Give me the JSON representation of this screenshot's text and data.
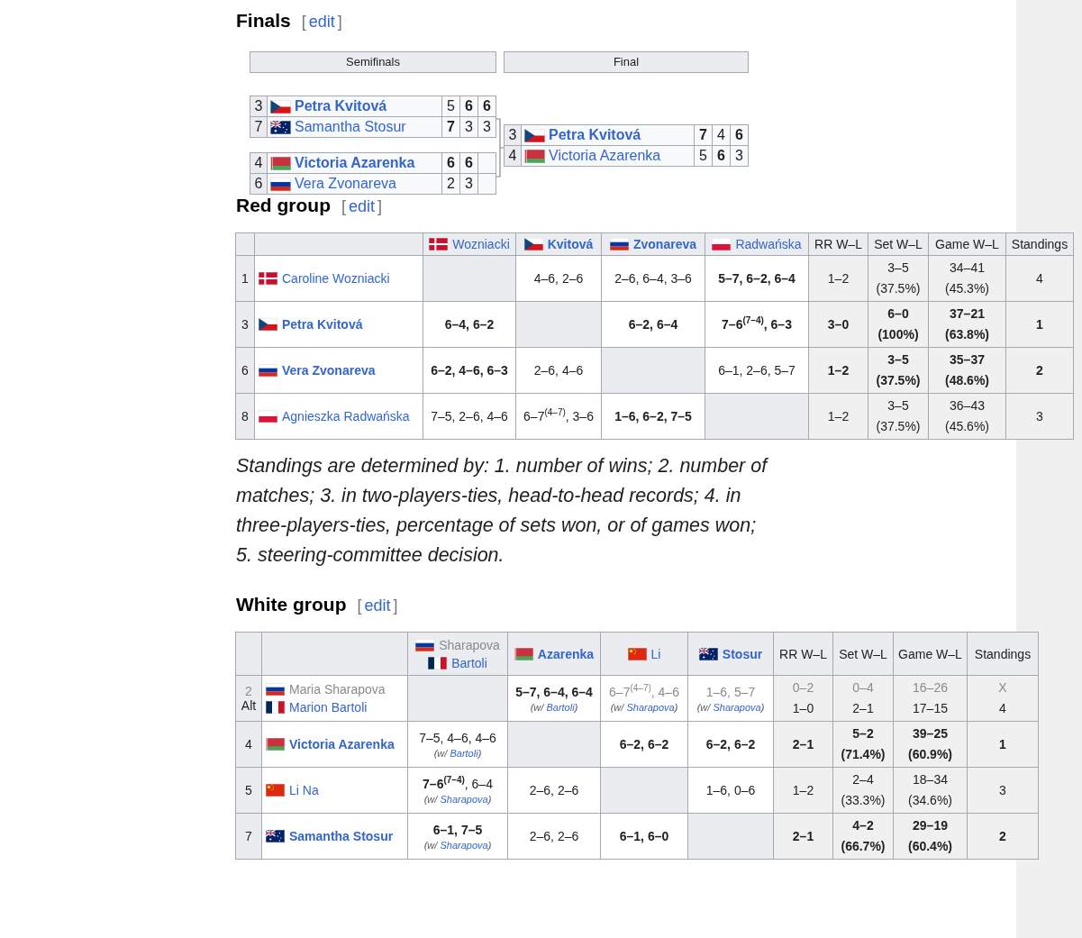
{
  "finals": {
    "heading": "Finals",
    "edit": {
      "open": "[",
      "label": "edit",
      "close": "]"
    },
    "rounds": [
      {
        "title": "Semifinals",
        "matches": [
          [
            {
              "seed": "3",
              "kind": "cze",
              "name": "Petra Kvitová",
              "bold": true,
              "scores": [
                {
                  "text": "5",
                  "bold": false
                },
                {
                  "text": "6",
                  "bold": true
                },
                {
                  "text": "6",
                  "bold": true
                }
              ]
            },
            {
              "seed": "7",
              "kind": "aus",
              "name": "Samantha Stosur",
              "bold": false,
              "scores": [
                {
                  "text": "7",
                  "bold": true
                },
                {
                  "text": "3",
                  "bold": false
                },
                {
                  "text": "3",
                  "bold": false
                }
              ]
            }
          ],
          [
            {
              "seed": "4",
              "kind": "blr",
              "name": "Victoria Azarenka",
              "bold": true,
              "scores": [
                {
                  "text": "6",
                  "bold": true
                },
                {
                  "text": "6",
                  "bold": true
                }
              ]
            },
            {
              "seed": "6",
              "kind": "rus",
              "name": "Vera Zvonareva",
              "bold": false,
              "scores": [
                {
                  "text": "2",
                  "bold": false
                },
                {
                  "text": "3",
                  "bold": false
                }
              ]
            }
          ]
        ]
      },
      {
        "title": "Final",
        "matches": [
          [
            {
              "seed": "3",
              "kind": "cze",
              "name": "Petra Kvitová",
              "bold": true,
              "scores": [
                {
                  "text": "7",
                  "bold": true
                },
                {
                  "text": "4",
                  "bold": false
                },
                {
                  "text": "6",
                  "bold": true
                }
              ]
            },
            {
              "seed": "4",
              "kind": "blr",
              "name": "Victoria Azarenka",
              "bold": false,
              "scores": [
                {
                  "text": "5",
                  "bold": false
                },
                {
                  "text": "6",
                  "bold": true
                },
                {
                  "text": "3",
                  "bold": false
                }
              ]
            }
          ]
        ]
      }
    ]
  },
  "red_group": {
    "heading": "Red group",
    "edit": {
      "open": "[",
      "label": "edit",
      "close": "]"
    },
    "columns": [
      {
        "players": [
          {
            "kind": "den",
            "name": "Wozniacki",
            "bold": false
          }
        ]
      },
      {
        "players": [
          {
            "kind": "cze",
            "name": "Kvitová",
            "bold": true
          }
        ]
      },
      {
        "players": [
          {
            "kind": "rus",
            "name": "Zvonareva",
            "bold": true
          }
        ]
      },
      {
        "players": [
          {
            "kind": "pol",
            "name": "Radwańska",
            "bold": false
          }
        ]
      }
    ],
    "stat_headers": [
      "RR W–L",
      "Set W–L",
      "Game W–L",
      "Standings"
    ],
    "rows": [
      {
        "seeds": [
          "1"
        ],
        "players": [
          {
            "kind": "den",
            "name": "Caroline Wozniacki",
            "bold": false
          }
        ],
        "bold": false,
        "cells": [
          {
            "kind": "diag"
          },
          {
            "kind": "score",
            "text": "4–6, 2–6",
            "bold": false
          },
          {
            "kind": "score",
            "text": "2–6, 6–4, 3–6",
            "bold": false
          },
          {
            "kind": "score",
            "text": "5–7, 6–2, 6–4",
            "bold": true
          }
        ],
        "stats": [
          {
            "values": [
              "1–2"
            ]
          },
          {
            "values": [
              "3–5",
              "(37.5%)"
            ]
          },
          {
            "values": [
              "34–41",
              "(45.3%)"
            ]
          },
          {
            "values": [
              "4"
            ]
          }
        ]
      },
      {
        "seeds": [
          "3"
        ],
        "players": [
          {
            "kind": "cze",
            "name": "Petra Kvitová",
            "bold": true
          }
        ],
        "bold": true,
        "cells": [
          {
            "kind": "score",
            "text": "6–4, 6–2",
            "bold": true
          },
          {
            "kind": "diag"
          },
          {
            "kind": "score",
            "text": "6–2, 6–4",
            "bold": true
          },
          {
            "kind": "score",
            "text": "7–6$^{(7–4)}$, 6–3",
            "bold": true
          }
        ],
        "stats": [
          {
            "values": [
              "3–0"
            ]
          },
          {
            "values": [
              "6–0",
              "(100%)"
            ]
          },
          {
            "values": [
              "37–21",
              "(63.8%)"
            ]
          },
          {
            "values": [
              "1"
            ]
          }
        ]
      },
      {
        "seeds": [
          "6"
        ],
        "players": [
          {
            "kind": "rus",
            "name": "Vera Zvonareva",
            "bold": true
          }
        ],
        "bold": true,
        "cells": [
          {
            "kind": "score",
            "text": "6–2, 4–6, 6–3",
            "bold": true
          },
          {
            "kind": "score",
            "text": "2–6, 4–6",
            "bold": false
          },
          {
            "kind": "diag"
          },
          {
            "kind": "score",
            "text": "6–1, 2–6, 5–7",
            "bold": false
          }
        ],
        "stats": [
          {
            "values": [
              "1–2"
            ]
          },
          {
            "values": [
              "3–5",
              "(37.5%)"
            ]
          },
          {
            "values": [
              "35–37",
              "(48.6%)"
            ]
          },
          {
            "values": [
              "2"
            ]
          }
        ]
      },
      {
        "seeds": [
          "8"
        ],
        "players": [
          {
            "kind": "pol",
            "name": "Agnieszka Radwańska",
            "bold": false
          }
        ],
        "bold": false,
        "cells": [
          {
            "kind": "score",
            "text": "7–5, 2–6, 4–6",
            "bold": false
          },
          {
            "kind": "score",
            "text": "6–7$^{(4–7)}$, 3–6",
            "bold": false
          },
          {
            "kind": "score",
            "text": "1–6, 6–2, 7–5",
            "bold": true
          },
          {
            "kind": "diag"
          }
        ],
        "stats": [
          {
            "values": [
              "1–2"
            ]
          },
          {
            "values": [
              "3–5",
              "(37.5%)"
            ]
          },
          {
            "values": [
              "36–43",
              "(45.6%)"
            ]
          },
          {
            "values": [
              "3"
            ]
          }
        ]
      }
    ]
  },
  "note": "Standings are determined by: 1. number of wins; 2. number of matches; 3. in two-players-ties, head-to-head records; 4. in three-players-ties, percentage of sets won, or of games won; 5. steering-committee decision.",
  "white_group": {
    "heading": "White group",
    "edit": {
      "open": "[",
      "label": "edit",
      "close": "]"
    },
    "columns": [
      {
        "players": [
          {
            "kind": "rus",
            "name": "Sharapova",
            "bold": false,
            "dim": true
          },
          {
            "kind": "fra",
            "name": "Bartoli",
            "bold": false,
            "dim": false
          }
        ]
      },
      {
        "players": [
          {
            "kind": "blr",
            "name": "Azarenka",
            "bold": true
          }
        ]
      },
      {
        "players": [
          {
            "kind": "chn",
            "name": "Li",
            "bold": false
          }
        ]
      },
      {
        "players": [
          {
            "kind": "aus",
            "name": "Stosur",
            "bold": true
          }
        ]
      }
    ],
    "stat_headers": [
      "RR W–L",
      "Set W–L",
      "Game W–L",
      "Standings"
    ],
    "rows": [
      {
        "seeds": [
          "2",
          "Alt"
        ],
        "players": [
          {
            "kind": "rus",
            "name": "Maria Sharapova",
            "bold": false,
            "dim": true
          },
          {
            "kind": "fra",
            "name": "Marion Bartoli",
            "bold": false,
            "dim": false
          }
        ],
        "bold": false,
        "cells": [
          {
            "kind": "diag"
          },
          {
            "kind": "score",
            "text": "5–7, 6–4, 6–4",
            "bold": true,
            "dim": false,
            "note": {
              "open": "(w/",
              "link": "Bartoli",
              "close": ")"
            }
          },
          {
            "kind": "score",
            "text": "6–7$^{(4–7)}$, 4–6",
            "bold": false,
            "dim": true,
            "note": {
              "open": "(w/",
              "link": "Sharapova",
              "close": ")"
            }
          },
          {
            "kind": "score",
            "text": "1–6, 5–7",
            "bold": false,
            "dim": true,
            "note": {
              "open": "(w/",
              "link": "Sharapova",
              "close": ")"
            }
          }
        ],
        "stats": [
          {
            "withdrawn": "0–2",
            "values": [
              "1–0"
            ]
          },
          {
            "withdrawn": "0–4",
            "values": [
              "2–1"
            ]
          },
          {
            "withdrawn": "16–26",
            "values": [
              "17–15"
            ]
          },
          {
            "withdrawn": "X",
            "values": [
              "4"
            ]
          }
        ]
      },
      {
        "seeds": [
          "4"
        ],
        "players": [
          {
            "kind": "blr",
            "name": "Victoria Azarenka",
            "bold": true
          }
        ],
        "bold": true,
        "cells": [
          {
            "kind": "score",
            "text": "7–5, 4–6, 4–6",
            "bold": false,
            "note": {
              "open": "(w/",
              "link": "Bartoli",
              "close": ")"
            }
          },
          {
            "kind": "diag"
          },
          {
            "kind": "score",
            "text": "6–2, 6–2",
            "bold": true
          },
          {
            "kind": "score",
            "text": "6–2, 6–2",
            "bold": true
          }
        ],
        "stats": [
          {
            "values": [
              "2–1"
            ]
          },
          {
            "values": [
              "5–2",
              "(71.4%)"
            ]
          },
          {
            "values": [
              "39–25",
              "(60.9%)"
            ]
          },
          {
            "values": [
              "1"
            ]
          }
        ]
      },
      {
        "seeds": [
          "5"
        ],
        "players": [
          {
            "kind": "chn",
            "name": "Li Na",
            "bold": false
          }
        ],
        "bold": false,
        "cells": [
          {
            "kind": "score",
            "text": "**7–6$^{(7–4)}$**, 6–4",
            "bold": false,
            "note": {
              "open": "(w/",
              "link": "Sharapova",
              "close": ")"
            }
          },
          {
            "kind": "score",
            "text": "2–6, 2–6",
            "bold": false
          },
          {
            "kind": "diag"
          },
          {
            "kind": "score",
            "text": "1–6, 0–6",
            "bold": false
          }
        ],
        "stats": [
          {
            "values": [
              "1–2"
            ]
          },
          {
            "values": [
              "2–4",
              "(33.3%)"
            ]
          },
          {
            "values": [
              "18–34",
              "(34.6%)"
            ]
          },
          {
            "values": [
              "3"
            ]
          }
        ]
      },
      {
        "seeds": [
          "7"
        ],
        "players": [
          {
            "kind": "aus",
            "name": "Samantha Stosur",
            "bold": true
          }
        ],
        "bold": true,
        "cells": [
          {
            "kind": "score",
            "text": "6–1, 7–5",
            "bold": true,
            "note": {
              "open": "(w/",
              "link": "Sharapova",
              "close": ")"
            }
          },
          {
            "kind": "score",
            "text": "2–6, 2–6",
            "bold": false
          },
          {
            "kind": "score",
            "text": "6–1, 6–0",
            "bold": true
          },
          {
            "kind": "diag"
          }
        ],
        "stats": [
          {
            "values": [
              "2–1"
            ]
          },
          {
            "values": [
              "4–2",
              "(66.7%)"
            ]
          },
          {
            "values": [
              "29–19",
              "(60.4%)"
            ]
          },
          {
            "values": [
              "2"
            ]
          }
        ]
      }
    ]
  }
}
